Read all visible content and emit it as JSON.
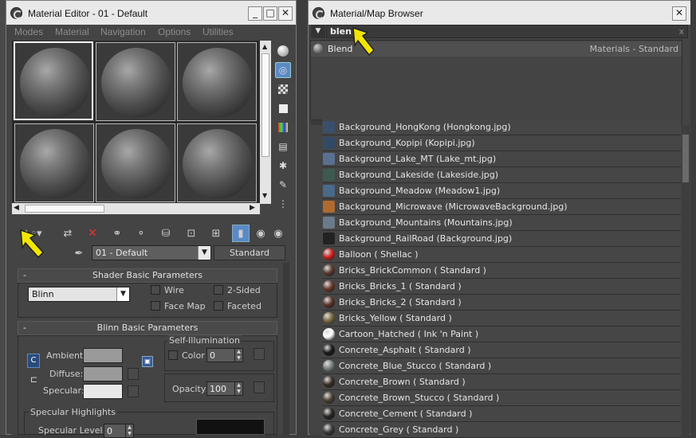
{
  "material_editor": {
    "title": "Material Editor - 01 - Default",
    "window_buttons": {
      "minimize": "_",
      "maximize": "□",
      "close": "✕"
    },
    "menu": [
      "Modes",
      "Material",
      "Navigation",
      "Options",
      "Utilities"
    ],
    "material_name": "01 - Default",
    "material_type": "Standard",
    "shader_rollout": {
      "title": "Shader Basic Parameters",
      "collapse": "-",
      "shader": "Blinn",
      "wire": "Wire",
      "two_sided": "2-Sided",
      "face_map": "Face Map",
      "faceted": "Faceted"
    },
    "blinn_rollout": {
      "title": "Blinn Basic Parameters",
      "collapse": "-",
      "ambient": "Ambient:",
      "diffuse": "Diffuse:",
      "specular": "Specular:",
      "self_illum": "Self-Illumination",
      "color": "Color",
      "color_value": "0",
      "opacity": "Opacity:",
      "opacity_value": "100",
      "spec_highlights": "Specular Highlights",
      "spec_level": "Specular Level:",
      "spec_level_value": "0"
    }
  },
  "browser": {
    "title": "Material/Map Browser",
    "close": "✕",
    "search_value": "blen",
    "search_clear": "x",
    "result": {
      "name": "Blend",
      "category": "Materials - Standard"
    },
    "items": [
      {
        "label": "Background_HongKong (Hongkong.jpg)",
        "icon": "#3a4f6a"
      },
      {
        "label": "Background_Kopipi (Kopipi.jpg)",
        "icon": "#334a66"
      },
      {
        "label": "Background_Lake_MT (Lake_mt.jpg)",
        "icon": "#5a7090"
      },
      {
        "label": "Background_Lakeside (Lakeside.jpg)",
        "icon": "#3e5a50"
      },
      {
        "label": "Background_Meadow (Meadow1.jpg)",
        "icon": "#4a6a8a"
      },
      {
        "label": "Background_Microwave (MicrowaveBackground.jpg)",
        "icon": "#b06a30"
      },
      {
        "label": "Background_Mountains (Mountains.jpg)",
        "icon": "#6a7a8a"
      },
      {
        "label": "Background_RailRoad (Background.jpg)",
        "icon": "#222222"
      },
      {
        "label": "Balloon ( Shellac )",
        "icon": "#d02020"
      },
      {
        "label": "Bricks_BrickCommon ( Standard )",
        "icon": "#5a3a30"
      },
      {
        "label": "Bricks_Bricks_1 ( Standard )",
        "icon": "#6a3a2a"
      },
      {
        "label": "Bricks_Bricks_2 ( Standard )",
        "icon": "#5a3428"
      },
      {
        "label": "Bricks_Yellow ( Standard )",
        "icon": "#7a6a40"
      },
      {
        "label": "Cartoon_Hatched ( Ink 'n Paint )",
        "icon": "#ffffff"
      },
      {
        "label": "Concrete_Asphalt ( Standard )",
        "icon": "#1a1a1a"
      },
      {
        "label": "Concrete_Blue_Stucco ( Standard )",
        "icon": "#7a8080"
      },
      {
        "label": "Concrete_Brown ( Standard )",
        "icon": "#3a3028"
      },
      {
        "label": "Concrete_Brown_Stucco ( Standard )",
        "icon": "#4a4035"
      },
      {
        "label": "Concrete_Cement ( Standard )",
        "icon": "#2a2622"
      },
      {
        "label": "Concrete_Grey ( Standard )",
        "icon": "#3a3a3a"
      }
    ]
  },
  "colors": {
    "accent": "#5a8ac6",
    "arrow": "#f2e600",
    "panel": "#444444"
  }
}
